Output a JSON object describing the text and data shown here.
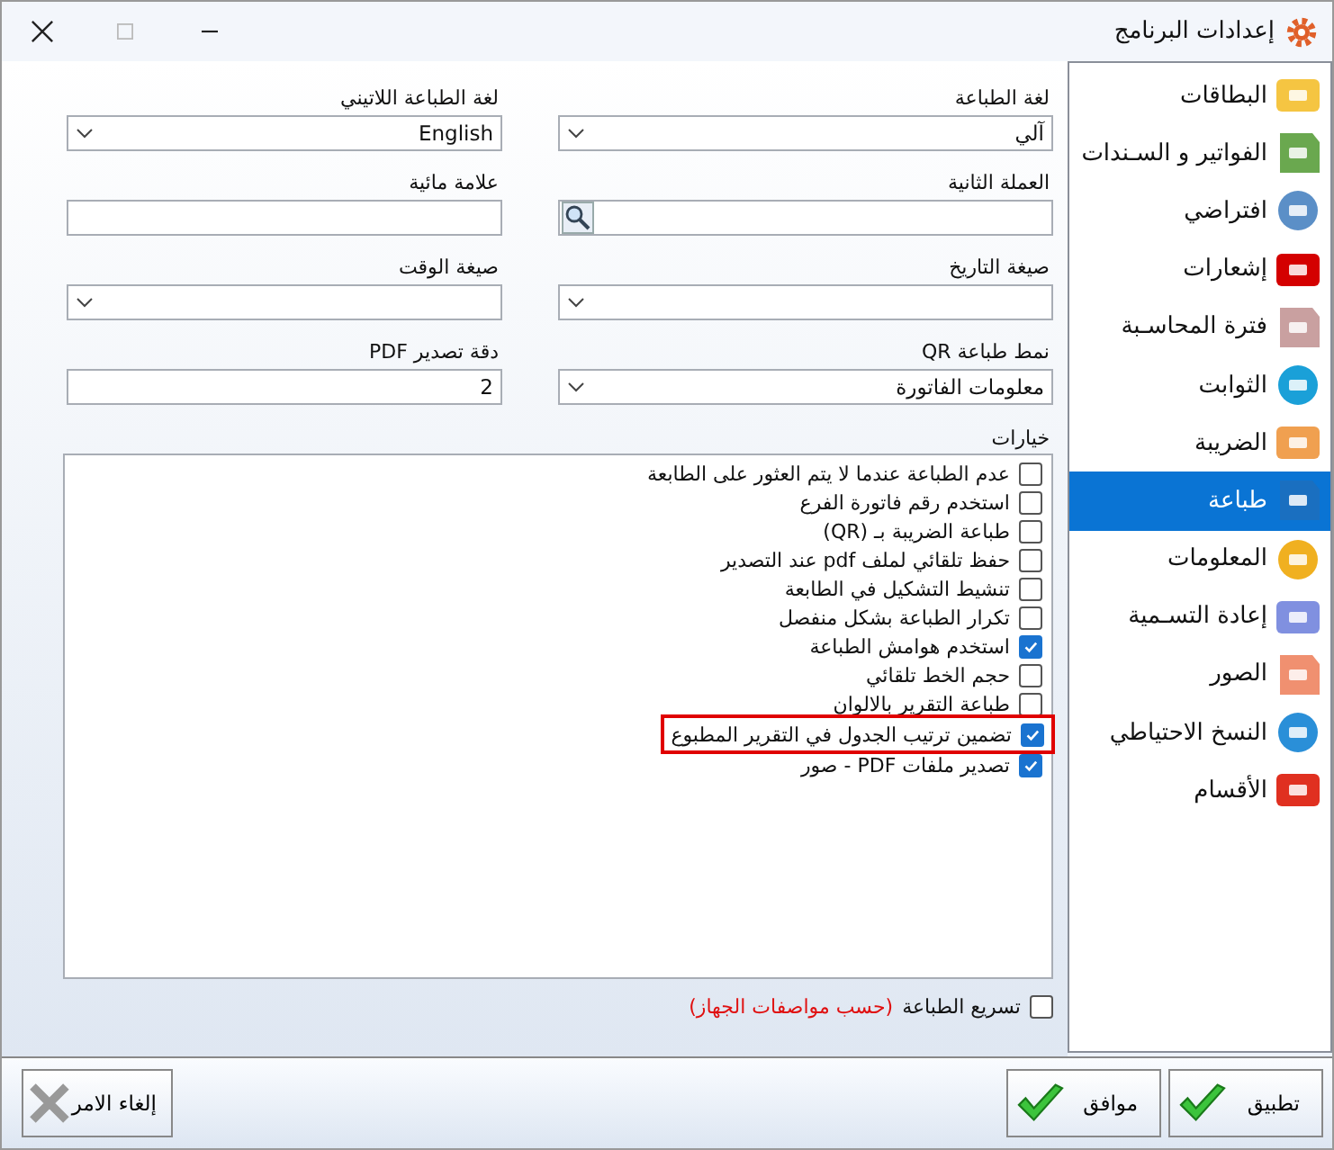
{
  "window": {
    "title": "إعدادات البرنامج"
  },
  "sidebar": {
    "items": [
      {
        "label": "البطاقات",
        "selected": false
      },
      {
        "label": "الفواتير و السـندات",
        "selected": false
      },
      {
        "label": "افتراضي",
        "selected": false
      },
      {
        "label": "إشعارات",
        "selected": false
      },
      {
        "label": "فترة المحاسـبة",
        "selected": false
      },
      {
        "label": "الثوابت",
        "selected": false
      },
      {
        "label": "الضريبة",
        "selected": false
      },
      {
        "label": "طباعة",
        "selected": true
      },
      {
        "label": "المعلومات",
        "selected": false
      },
      {
        "label": "إعادة التسـمية",
        "selected": false
      },
      {
        "label": "الصور",
        "selected": false
      },
      {
        "label": "النسخ الاحتياطي",
        "selected": false
      },
      {
        "label": "الأقسام",
        "selected": false
      }
    ]
  },
  "fields": [
    {
      "label": "لغة الطباعة",
      "kind": "select",
      "value": "آلي"
    },
    {
      "label": "لغة الطباعة اللاتيني",
      "kind": "select",
      "value": "English"
    },
    {
      "label": "العملة الثانية",
      "kind": "lookup"
    },
    {
      "label": "علامة مائية",
      "kind": "text"
    },
    {
      "label": "صيغة التاريخ",
      "kind": "select"
    },
    {
      "label": "صيغة الوقت",
      "kind": "select"
    },
    {
      "label": "نمط طباعة QR",
      "kind": "select",
      "value": "معلومات الفاتورة"
    },
    {
      "label": "دقة تصدير PDF",
      "kind": "text",
      "value": "2"
    }
  ],
  "options": {
    "label": "خيارات",
    "items": [
      {
        "label": "عدم الطباعة عندما لا يتم العثور على الطابعة",
        "checked": false,
        "highlighted": false
      },
      {
        "label": "استخدم رقم فاتورة الفرع",
        "checked": false,
        "highlighted": false
      },
      {
        "label": "طباعة الضريبة بـ (QR)",
        "checked": false,
        "highlighted": false
      },
      {
        "label": "حفظ تلقائي لملف pdf عند التصدير",
        "checked": false,
        "highlighted": false
      },
      {
        "label": "تنشيط التشكيل في الطابعة",
        "checked": false,
        "highlighted": false
      },
      {
        "label": "تكرار الطباعة بشكل منفصل",
        "checked": false,
        "highlighted": false
      },
      {
        "label": "استخدم هوامش الطباعة",
        "checked": true,
        "highlighted": false
      },
      {
        "label": "حجم الخط تلقائي",
        "checked": false,
        "highlighted": false
      },
      {
        "label": "طباعة التقرير بالالوان",
        "checked": false,
        "highlighted": false
      },
      {
        "label": "تضمين ترتيب الجدول في التقرير المطبوع",
        "checked": true,
        "highlighted": true
      },
      {
        "label": "تصدير ملفات PDF - صور",
        "checked": true,
        "highlighted": false
      }
    ]
  },
  "speed_option": {
    "label": "تسريع الطباعة",
    "note": "(حسب مواصفات الجهاز)",
    "checked": false
  },
  "buttons": [
    {
      "label": "تطبيق",
      "kind": "ok"
    },
    {
      "label": "موافق",
      "kind": "ok"
    },
    {
      "label": "إلغاء الامر",
      "kind": "cancel"
    }
  ]
}
